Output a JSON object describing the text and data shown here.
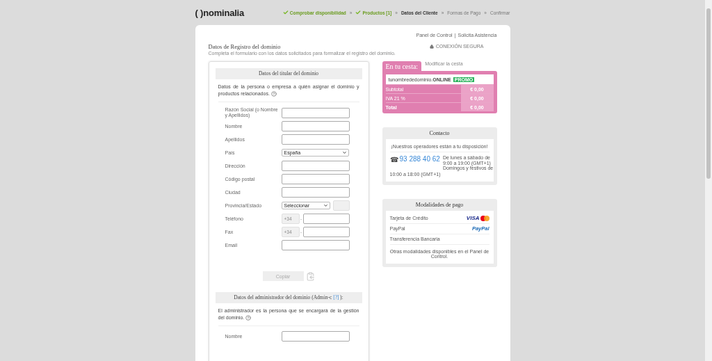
{
  "header": {
    "logo": "( )nominalia",
    "steps": [
      {
        "label": "Comprobar disponibilidad",
        "done": true,
        "selected": false,
        "separator": "»"
      },
      {
        "label": "Productos [1]",
        "done": true,
        "selected": false,
        "separator": "»"
      },
      {
        "label": "Datos del Cliente",
        "done": false,
        "selected": true,
        "separator": "»"
      },
      {
        "label": "Formas de Pago",
        "done": false,
        "selected": false,
        "separator": "»"
      },
      {
        "label": "Confirmar",
        "done": false,
        "selected": false
      }
    ]
  },
  "top_links": {
    "items": [
      "Panel de Control",
      "Solicita Asistencia"
    ],
    "separator": "|"
  },
  "page_title": "Datos de Registro del dominio",
  "page_subtitle": "Completa el formulario con los datos solicitados para formalizar el registro del dominio.",
  "secure_label": "CONEXIÓN SEGURA",
  "holder_section": {
    "title": "Datos del titular del dominio",
    "description": "Datos de la persona o empresa a quién asignar el dominio y productos relacionados.",
    "fields": [
      {
        "label": "Razón Social (o Nombre y Apellidos)",
        "kind": "text"
      },
      {
        "label": "Nombre",
        "kind": "text"
      },
      {
        "label": "Apellidos",
        "kind": "text"
      },
      {
        "label": "País",
        "kind": "select",
        "value": "España"
      },
      {
        "label": "Dirección",
        "kind": "text"
      },
      {
        "label": "Código postal",
        "kind": "text"
      },
      {
        "label": "Ciudad",
        "kind": "text"
      },
      {
        "label": "Provincia/Estado",
        "kind": "select_extra",
        "value": "Seleccionar"
      },
      {
        "label": "Teléfono",
        "kind": "phone",
        "prefix": "+34",
        "separator": "-"
      },
      {
        "label": "Fax",
        "kind": "phone",
        "prefix": "+34",
        "separator": "-"
      },
      {
        "label": "Email",
        "kind": "text"
      }
    ]
  },
  "copy_button": {
    "label": "Copiar",
    "disabled": true
  },
  "admin_section": {
    "title_start": "Datos del administrador del dominio (Admin-c ",
    "title_link": "[?]",
    "title_end": "):",
    "description": "El administrador es la persona que se encargará de la gestión del dominio.",
    "fields": [
      {
        "label": "Nombre",
        "kind": "text"
      }
    ]
  },
  "cart": {
    "title": "En tu cesta:",
    "edit_link": "Modificar la cesta",
    "item": {
      "name": "tunombrededominio.",
      "tld": "ONLINE",
      "badge": "PROMO"
    },
    "rows": [
      {
        "label": "Subtotal",
        "value": "€ 0,00",
        "kind": "normal"
      },
      {
        "label": "IVA 21 %",
        "value": "€ 0,00",
        "kind": "normal"
      },
      {
        "label": "Total",
        "value": "€ 0,00",
        "kind": "total"
      }
    ]
  },
  "contact": {
    "title": "Contacto",
    "tagline": "¡Nuestros operadores están a tu disposición!",
    "phone_icon": "☎",
    "phone": "93 288 40 62",
    "hours_lines": [
      "De lunes a sábado de",
      "9:00 a 19:00 (GMT+1)",
      "Domingos y festivos de"
    ],
    "hours_bottom": "10:00 a 18:00 (GMT+1)"
  },
  "payment": {
    "title": "Modalidades de pago",
    "methods": [
      {
        "label": "Tarjeta de Crédito",
        "kind": "card",
        "logo_text": "VISA"
      },
      {
        "label": "PayPal",
        "kind": "paypal",
        "logo_text": "PayPal"
      },
      {
        "label": "Transferencia Bancaria",
        "kind": "plain"
      }
    ],
    "note": "Otras modalidades disponibles en el Panel de Control."
  }
}
